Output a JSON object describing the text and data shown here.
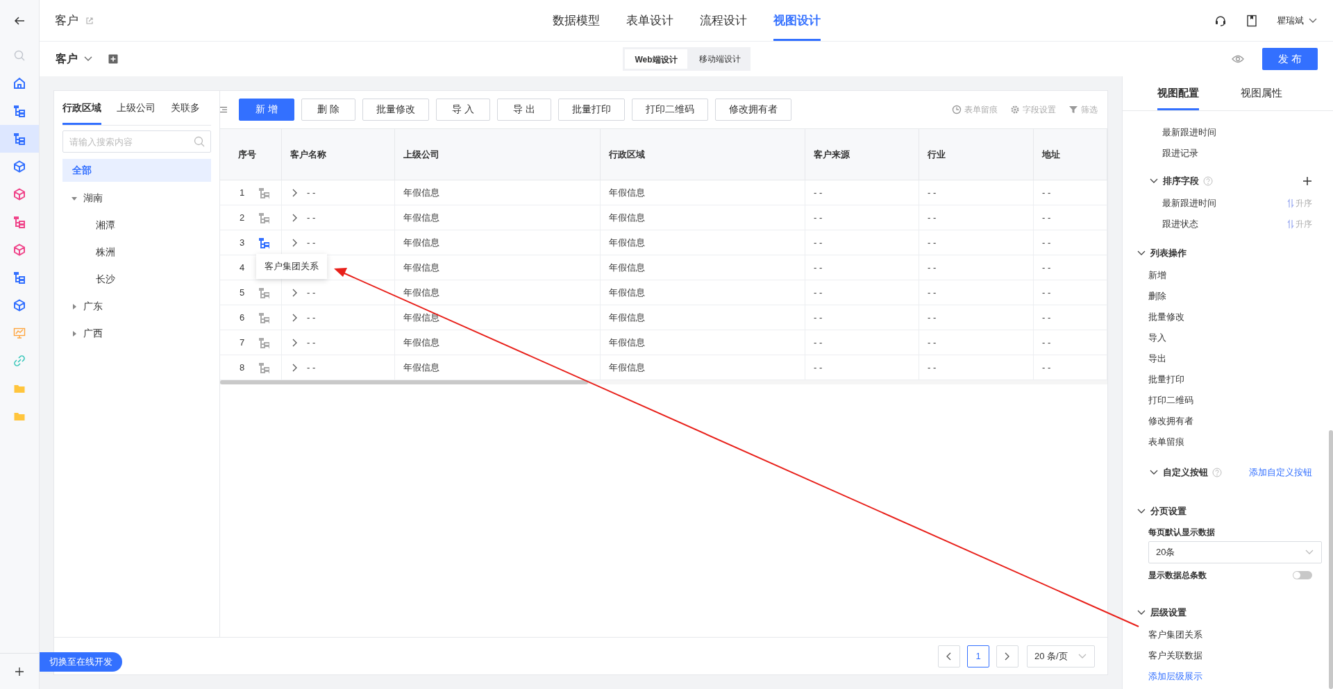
{
  "rail": {
    "items": [
      {
        "kind": "search",
        "color": "#c0c4cc",
        "selected": false
      },
      {
        "kind": "home",
        "color": "#3370ff",
        "selected": false
      },
      {
        "kind": "tree",
        "color": "#3370ff",
        "selected": false
      },
      {
        "kind": "tree",
        "color": "#3370ff",
        "selected": true
      },
      {
        "kind": "cube",
        "color": "#3370ff",
        "selected": false
      },
      {
        "kind": "cube",
        "color": "#f0458a",
        "selected": false
      },
      {
        "kind": "tree",
        "color": "#f0458a",
        "selected": false
      },
      {
        "kind": "cube",
        "color": "#f0458a",
        "selected": false
      },
      {
        "kind": "tree",
        "color": "#3370ff",
        "selected": false
      },
      {
        "kind": "cube",
        "color": "#3370ff",
        "selected": false
      },
      {
        "kind": "chart",
        "color": "#ffa53d",
        "selected": false
      },
      {
        "kind": "link",
        "color": "#2ec4b6",
        "selected": false
      },
      {
        "kind": "folder",
        "color": "#ffc53d",
        "selected": false
      },
      {
        "kind": "folder",
        "color": "#ffc53d",
        "selected": false
      }
    ]
  },
  "header": {
    "title": "客户",
    "tabs": [
      {
        "label": "数据模型",
        "selected": false
      },
      {
        "label": "表单设计",
        "selected": false
      },
      {
        "label": "流程设计",
        "selected": false
      },
      {
        "label": "视图设计",
        "selected": true
      }
    ],
    "user": "瞿瑞斌"
  },
  "subheader": {
    "view": "客户",
    "modes": [
      {
        "label": "Web端设计",
        "selected": true
      },
      {
        "label": "移动端设计",
        "selected": false
      }
    ],
    "publish": "发 布"
  },
  "filter_panel": {
    "tabs": [
      {
        "label": "行政区域",
        "selected": true
      },
      {
        "label": "上级公司",
        "selected": false
      },
      {
        "label": "关联多",
        "selected": false
      }
    ],
    "search": {
      "placeholder": "请输入搜索内容"
    },
    "tree": [
      {
        "label": "全部",
        "selected": true
      },
      {
        "label": "湖南",
        "selected": false,
        "expanded": true,
        "children": [
          {
            "label": "湘潭",
            "selected": false
          },
          {
            "label": "株洲",
            "selected": false
          },
          {
            "label": "长沙",
            "selected": false
          }
        ]
      },
      {
        "label": "广东",
        "selected": false,
        "expanded": false
      },
      {
        "label": "广西",
        "selected": false,
        "expanded": false
      }
    ]
  },
  "toolbar": {
    "buttons": [
      {
        "label": "新 增",
        "kind": "primary"
      },
      {
        "label": "删 除",
        "kind": "default"
      },
      {
        "label": "批量修改",
        "kind": "default"
      },
      {
        "label": "导 入",
        "kind": "default"
      },
      {
        "label": "导 出",
        "kind": "default"
      },
      {
        "label": "批量打印",
        "kind": "default"
      },
      {
        "label": "打印二维码",
        "kind": "default"
      },
      {
        "label": "修改拥有者",
        "kind": "default"
      }
    ],
    "tools": [
      {
        "kind": "history",
        "label": "表单留痕"
      },
      {
        "kind": "settings",
        "label": "字段设置"
      },
      {
        "kind": "filter",
        "label": "筛选"
      }
    ]
  },
  "table": {
    "columns": [
      "序号",
      "客户名称",
      "上级公司",
      "行政区域",
      "客户来源",
      "行业",
      "地址"
    ],
    "rows": [
      {
        "hierarchy_icon_active": false,
        "cells": [
          "1",
          "- -",
          "年假信息",
          "年假信息",
          "- -",
          "- -",
          "- -"
        ]
      },
      {
        "hierarchy_icon_active": false,
        "cells": [
          "2",
          "- -",
          "年假信息",
          "年假信息",
          "- -",
          "- -",
          "- -"
        ]
      },
      {
        "hierarchy_icon_active": true,
        "cells": [
          "3",
          "- -",
          "年假信息",
          "年假信息",
          "- -",
          "- -",
          "- -"
        ]
      },
      {
        "cells": [
          "4",
          "",
          "年假信息",
          "年假信息",
          "- -",
          "- -",
          "- -"
        ]
      },
      {
        "hierarchy_icon_active": false,
        "cells": [
          "5",
          "- -",
          "年假信息",
          "年假信息",
          "- -",
          "- -",
          "- -"
        ]
      },
      {
        "hierarchy_icon_active": false,
        "cells": [
          "6",
          "- -",
          "年假信息",
          "年假信息",
          "- -",
          "- -",
          "- -"
        ]
      },
      {
        "hierarchy_icon_active": false,
        "cells": [
          "7",
          "- -",
          "年假信息",
          "年假信息",
          "- -",
          "- -",
          "- -"
        ]
      },
      {
        "hierarchy_icon_active": false,
        "cells": [
          "8",
          "- -",
          "年假信息",
          "年假信息",
          "- -",
          "- -",
          "- -"
        ]
      }
    ],
    "tooltip": "客户集团关系"
  },
  "pagination": {
    "pages": [
      {
        "label": "1",
        "selected": true
      }
    ],
    "page_size": "20 条/页"
  },
  "switch_button": "切换至在线开发",
  "config_panel": {
    "tabs": [
      {
        "label": "视图配置",
        "selected": true
      },
      {
        "label": "视图属性",
        "selected": false
      }
    ],
    "fields": [
      "最新跟进时间",
      "跟进记录"
    ],
    "sort": {
      "title": "排序字段",
      "items": [
        {
          "label": "最新跟进时间",
          "order": "升序"
        },
        {
          "label": "跟进状态",
          "order": "升序"
        }
      ]
    },
    "list_actions": {
      "title": "列表操作",
      "expanded": true,
      "items": [
        "新增",
        "删除",
        "批量修改",
        "导入",
        "导出",
        "批量打印",
        "打印二维码",
        "修改拥有者",
        "表单留痕"
      ]
    },
    "custom_buttons": {
      "title": "自定义按钮",
      "link": "添加自定义按钮"
    },
    "paging": {
      "title": "分页设置",
      "expanded": true,
      "label": "每页默认显示数据",
      "value": "20条",
      "toggle": {
        "label": "显示数据总条数",
        "on": false
      }
    },
    "hierarchy": {
      "title": "层级设置",
      "expanded": true,
      "items": [
        "客户集团关系",
        "客户关联数据"
      ],
      "link": "添加层级展示"
    }
  }
}
